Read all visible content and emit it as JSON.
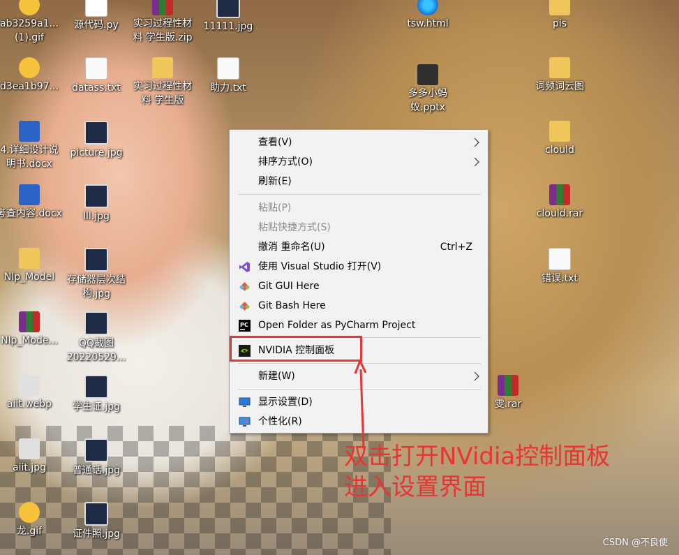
{
  "desktop_icons": [
    {
      "label": "ab3259a1...(1).gif",
      "type": "gif",
      "icon": "gif-file-icon"
    },
    {
      "label": "源代码.py",
      "type": "py",
      "icon": "python-file-icon"
    },
    {
      "label": "实习过程性材料 学生版.zip",
      "type": "zip",
      "icon": "winrar-archive-icon"
    },
    {
      "label": "11111.jpg",
      "type": "pic",
      "icon": "image-file-icon"
    },
    {
      "label": "tsw.html",
      "type": "edge",
      "icon": "edge-html-icon"
    },
    {
      "label": "pis",
      "type": "folder",
      "icon": "folder-icon"
    },
    {
      "label": "d3ea1b97...",
      "type": "gif",
      "icon": "gif-file-icon"
    },
    {
      "label": "datass.txt",
      "type": "txt",
      "icon": "text-file-icon"
    },
    {
      "label": "实习过程性材料 学生版",
      "type": "folder",
      "icon": "folder-icon"
    },
    {
      "label": "助力.txt",
      "type": "txt",
      "icon": "text-file-icon"
    },
    {
      "label": "多多小蚂蚁.pptx",
      "type": "ppt",
      "icon": "pptx-file-icon"
    },
    {
      "label": "词频词云图",
      "type": "folder",
      "icon": "folder-icon"
    },
    {
      "label": "4.详细设计说明书.docx",
      "type": "doc",
      "icon": "word-file-icon"
    },
    {
      "label": "picture.jpg",
      "type": "pic",
      "icon": "image-file-icon"
    },
    {
      "label": "clould",
      "type": "folder",
      "icon": "folder-icon"
    },
    {
      "label": "考查内容.docx",
      "type": "doc",
      "icon": "word-file-icon"
    },
    {
      "label": "lll.jpg",
      "type": "pic",
      "icon": "image-file-icon"
    },
    {
      "label": "clould.rar",
      "type": "zip",
      "icon": "winrar-archive-icon"
    },
    {
      "label": "Nlp_Model",
      "type": "folder",
      "icon": "folder-icon"
    },
    {
      "label": "存储器层次结构.jpg",
      "type": "pic",
      "icon": "image-file-icon"
    },
    {
      "label": "错误.txt",
      "type": "txt",
      "icon": "text-file-icon"
    },
    {
      "label": "Nlp_Mode...",
      "type": "zip",
      "icon": "winrar-archive-icon"
    },
    {
      "label": "QQ截图20220529...",
      "type": "pic",
      "icon": "image-file-icon"
    },
    {
      "label": "aiit.webp",
      "type": "web",
      "icon": "webp-file-icon"
    },
    {
      "label": "学生证.jpg",
      "type": "pic",
      "icon": "image-file-icon"
    },
    {
      "label": "雯.rar",
      "type": "zip",
      "icon": "winrar-archive-icon"
    },
    {
      "label": "aiit.jpg",
      "type": "web",
      "icon": "image-file-icon"
    },
    {
      "label": "普通话.jpg",
      "type": "pic",
      "icon": "image-file-icon"
    },
    {
      "label": "龙.gif",
      "type": "gif",
      "icon": "gif-file-icon"
    },
    {
      "label": "证件照.jpg",
      "type": "pic",
      "icon": "image-file-icon"
    }
  ],
  "menu": {
    "items": [
      {
        "label": "查看(V)",
        "submenu": true
      },
      {
        "label": "排序方式(O)",
        "submenu": true
      },
      {
        "label": "刷新(E)"
      },
      {
        "label": "粘贴(P)",
        "disabled": true
      },
      {
        "label": "粘贴快捷方式(S)",
        "disabled": true
      },
      {
        "label": "撤消 重命名(U)",
        "shortcut": "Ctrl+Z"
      },
      {
        "label": "使用 Visual Studio 打开(V)",
        "icon": "visual-studio-icon"
      },
      {
        "label": "Git GUI Here",
        "icon": "git-icon"
      },
      {
        "label": "Git Bash Here",
        "icon": "git-icon"
      },
      {
        "label": "Open Folder as PyCharm Project",
        "icon": "pycharm-icon"
      },
      {
        "label": "NVIDIA 控制面板",
        "icon": "nvidia-icon"
      },
      {
        "label": "新建(W)",
        "submenu": true
      },
      {
        "label": "显示设置(D)",
        "icon": "display-settings-icon"
      },
      {
        "label": "个性化(R)",
        "icon": "personalize-icon"
      }
    ]
  },
  "annotation": {
    "line1": "双击打开NVidia控制面板",
    "line2": "进入设置界面",
    "color": "#ea3333"
  },
  "watermark": "CSDN @不良使"
}
